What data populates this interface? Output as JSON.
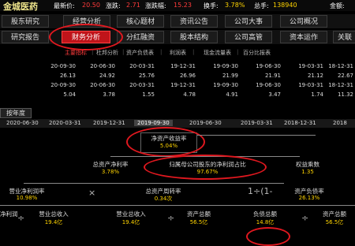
{
  "header": {
    "stock_name": "金城医药",
    "latest_price_label": "最新价:",
    "latest_price": "20.50",
    "change_label": "涨跌:",
    "change": "2.71",
    "change_pct_label": "涨跌幅:",
    "change_pct": "15.23",
    "turnover_label": "换手:",
    "turnover": "3.78%",
    "volume_label": "总手:",
    "volume": "138940",
    "amount_label": "金额:"
  },
  "nav_row1": [
    "股东研究",
    "经营分析",
    "核心题材",
    "资讯公告",
    "公司大事",
    "公司概况"
  ],
  "nav_row2": [
    "研究报告",
    "财务分析",
    "分红融资",
    "股本结构",
    "公司高管",
    "资本运作",
    "关联"
  ],
  "subtabs": [
    "主要指标",
    "杜邦分析",
    "资产负债表",
    "利润表",
    "现金流量表",
    "百分比报表"
  ],
  "table": {
    "dates_a": [
      "20-09-30",
      "20-06-30",
      "20-03-31",
      "19-12-31",
      "19-09-30",
      "19-06-30",
      "19-03-31",
      "18-12-31"
    ],
    "vals_a": [
      "26.13",
      "24.92",
      "25.76",
      "26.96",
      "21.99",
      "21.91",
      "21.12",
      "22.67"
    ],
    "dates_b": [
      "20-09-30",
      "20-06-30",
      "20-03-31",
      "19-12-31",
      "19-09-30",
      "19-06-30",
      "19-03-31",
      "18-12-31"
    ],
    "vals_b": [
      "5.04",
      "3.78",
      "1.55",
      "4.78",
      "4.91",
      "3.47",
      "1.74",
      "11.32"
    ]
  },
  "period": {
    "label": "按年度",
    "dates": [
      "2020-06-30",
      "2020-03-31",
      "2019-12-31",
      "2019-09-30",
      "2019-06-30",
      "2019-03-31",
      "2018-12-31",
      "2018"
    ]
  },
  "dupont": {
    "roe": {
      "label": "净资产收益率",
      "value": "5.04%"
    },
    "roa": {
      "label": "总资产净利率",
      "value": "3.78%"
    },
    "parent_ratio": {
      "label": "归属母公司股东的净利润占比",
      "value": "97.67%"
    },
    "equity_mult": {
      "label": "权益乘数",
      "value": "1.35"
    },
    "net_margin": {
      "label": "营业净利润率",
      "value": "10.98%"
    },
    "asset_turn": {
      "label": "总资产周转率",
      "value": "0.34次"
    },
    "debt_ratio": {
      "label": "资产负债率",
      "value": "26.13%"
    },
    "net_profit": {
      "label": "净利润",
      "value": ""
    },
    "rev1": {
      "label": "营业总收入",
      "value": "19.4亿"
    },
    "rev2": {
      "label": "营业总收入",
      "value": "19.4亿"
    },
    "assets1": {
      "label": "资产总额",
      "value": "56.5亿"
    },
    "liab": {
      "label": "负债总额",
      "value": "14.8亿"
    },
    "assets2": {
      "label": "资产总额",
      "value": "56.5亿"
    },
    "formula": "1÷(1-"
  },
  "colors": {
    "accent": "#c0141a",
    "value": "#ffd400",
    "up": "#ff3b3b"
  }
}
